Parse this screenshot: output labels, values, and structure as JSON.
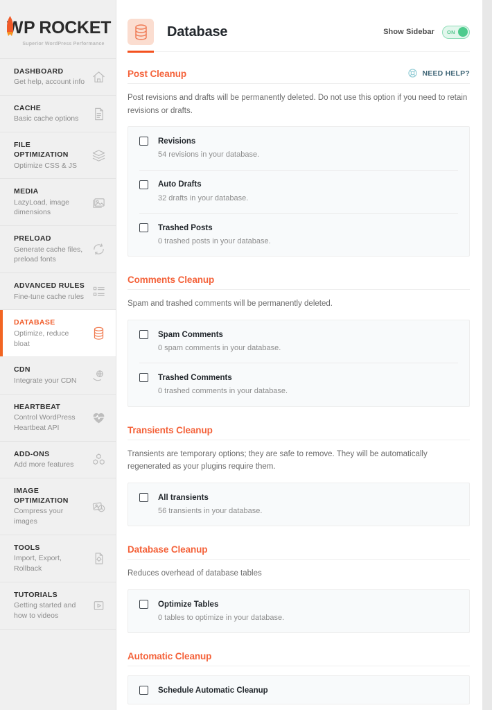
{
  "sidebar": {
    "logo": {
      "word_w": "W",
      "word_p": "P",
      "word_rocket": "ROCKET",
      "tagline": "Superior WordPress Performance"
    },
    "items": [
      {
        "title": "DASHBOARD",
        "desc": "Get help, account info",
        "icon": "home-icon",
        "active": false
      },
      {
        "title": "CACHE",
        "desc": "Basic cache options",
        "icon": "document-icon",
        "active": false
      },
      {
        "title": "FILE OPTIMIZATION",
        "desc": "Optimize CSS & JS",
        "icon": "layers-icon",
        "active": false
      },
      {
        "title": "MEDIA",
        "desc": "LazyLoad, image dimensions",
        "icon": "image-icon",
        "active": false
      },
      {
        "title": "PRELOAD",
        "desc": "Generate cache files, preload fonts",
        "icon": "refresh-icon",
        "active": false
      },
      {
        "title": "ADVANCED RULES",
        "desc": "Fine-tune cache rules",
        "icon": "list-icon",
        "active": false
      },
      {
        "title": "DATABASE",
        "desc": "Optimize, reduce bloat",
        "icon": "database-icon",
        "active": true
      },
      {
        "title": "CDN",
        "desc": "Integrate your CDN",
        "icon": "cloud-globe-icon",
        "active": false
      },
      {
        "title": "HEARTBEAT",
        "desc": "Control WordPress Heartbeat API",
        "icon": "heart-pulse-icon",
        "active": false
      },
      {
        "title": "ADD-ONS",
        "desc": "Add more features",
        "icon": "blocks-icon",
        "active": false
      },
      {
        "title": "IMAGE OPTIMIZATION",
        "desc": "Compress your images",
        "icon": "photos-icon",
        "active": false
      },
      {
        "title": "TOOLS",
        "desc": "Import, Export, Rollback",
        "icon": "file-gear-icon",
        "active": false
      },
      {
        "title": "TUTORIALS",
        "desc": "Getting started and how to videos",
        "icon": "video-icon",
        "active": false
      }
    ]
  },
  "header": {
    "icon": "database-icon",
    "title": "Database",
    "sidebar_toggle_label": "Show Sidebar",
    "toggle_state": "ON"
  },
  "need_help": {
    "icon": "lifebuoy-icon",
    "label": "NEED HELP?"
  },
  "sections": [
    {
      "title": "Post Cleanup",
      "description": "Post revisions and drafts will be permanently deleted. Do not use this option if you need to retain revisions or drafts.",
      "options": [
        {
          "label": "Revisions",
          "sub": "54 revisions in your database.",
          "checked": false
        },
        {
          "label": "Auto Drafts",
          "sub": "32 drafts in your database.",
          "checked": false
        },
        {
          "label": "Trashed Posts",
          "sub": "0 trashed posts in your database.",
          "checked": false
        }
      ]
    },
    {
      "title": "Comments Cleanup",
      "description": "Spam and trashed comments will be permanently deleted.",
      "options": [
        {
          "label": "Spam Comments",
          "sub": "0 spam comments in your database.",
          "checked": false
        },
        {
          "label": "Trashed Comments",
          "sub": "0 trashed comments in your database.",
          "checked": false
        }
      ]
    },
    {
      "title": "Transients Cleanup",
      "description": "Transients are temporary options; they are safe to remove. They will be automatically regenerated as your plugins require them.",
      "options": [
        {
          "label": "All transients",
          "sub": "56 transients in your database.",
          "checked": false
        }
      ]
    },
    {
      "title": "Database Cleanup",
      "description": "Reduces overhead of database tables",
      "options": [
        {
          "label": "Optimize Tables",
          "sub": "0 tables to optimize in your database.",
          "checked": false
        }
      ]
    },
    {
      "title": "Automatic Cleanup",
      "description": "",
      "options": [
        {
          "label": "Schedule Automatic Cleanup",
          "sub": "",
          "checked": false
        }
      ]
    }
  ],
  "colors": {
    "brand_orange": "#f26522",
    "section_orange": "#f4623a",
    "toggle_green": "#4ecb8d",
    "need_help_teal": "#3d6475",
    "sidebar_bg": "#f0f0f0",
    "option_bg": "#f8fafb"
  }
}
